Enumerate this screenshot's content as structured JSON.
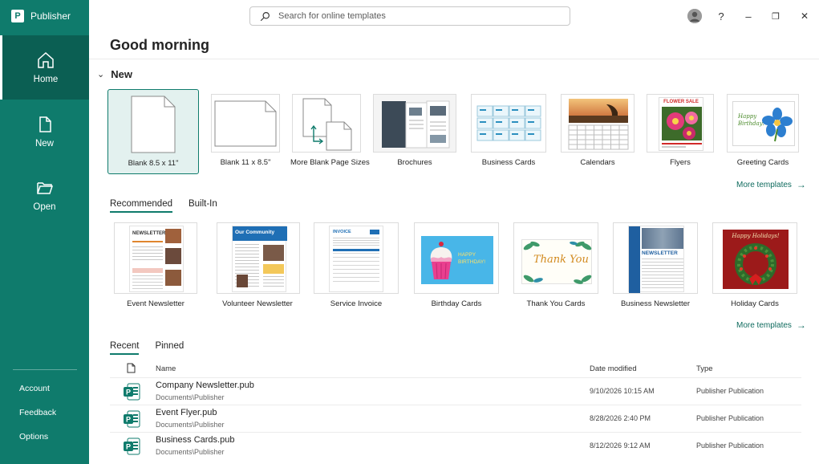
{
  "app": {
    "name": "Publisher",
    "logo_letter": "P"
  },
  "nav": {
    "home": "Home",
    "new": "New",
    "open": "Open"
  },
  "sidebar_footer": {
    "account": "Account",
    "feedback": "Feedback",
    "options": "Options"
  },
  "search": {
    "placeholder": "Search for online templates"
  },
  "window": {
    "help": "?",
    "minimize": "–",
    "restore": "❐",
    "close": "✕"
  },
  "greeting": "Good morning",
  "new_section": {
    "label": "New",
    "templates": [
      "Blank 8.5 x 11\"",
      "Blank 11 x 8.5\"",
      "More Blank Page Sizes",
      "Brochures",
      "Business Cards",
      "Calendars",
      "Flyers",
      "Greeting Cards"
    ],
    "more": "More templates"
  },
  "recommended_tabs": [
    "Recommended",
    "Built-In"
  ],
  "recommended": {
    "items": [
      "Event Newsletter",
      "Volunteer Newsletter",
      "Service Invoice",
      "Birthday Cards",
      "Thank You Cards",
      "Business Newsletter",
      "Holiday Cards"
    ],
    "thumb_text": {
      "newsletter": "NEWSLETTER",
      "community": "Our Community",
      "invoice": "INVOICE",
      "birthday": "HAPPY\nBIRTHDAY!",
      "thankyou": "Thank You",
      "business_newsletter": "NEWSLETTER",
      "holiday": "Happy Holidays!"
    },
    "more": "More templates"
  },
  "flyer_thumb": "FLOWER SALE",
  "greeting_thumb": "Happy Birthday!",
  "recent_tabs": [
    "Recent",
    "Pinned"
  ],
  "recent": {
    "columns": {
      "name": "Name",
      "date": "Date modified",
      "type": "Type"
    },
    "rows": [
      {
        "name": "Company Newsletter.pub",
        "path": "Documents\\Publisher",
        "date": "9/10/2026 10:15 AM",
        "type": "Publisher Publication"
      },
      {
        "name": "Event Flyer.pub",
        "path": "Documents\\Publisher",
        "date": "8/28/2026 2:40 PM",
        "type": "Publisher Publication"
      },
      {
        "name": "Business Cards.pub",
        "path": "Documents\\Publisher",
        "date": "8/12/2026 9:12 AM",
        "type": "Publisher Publication"
      }
    ]
  },
  "colors": {
    "accent": "#0f7b6c",
    "sidebar_active": "#0b5f53",
    "link": "#0f6b5e"
  }
}
